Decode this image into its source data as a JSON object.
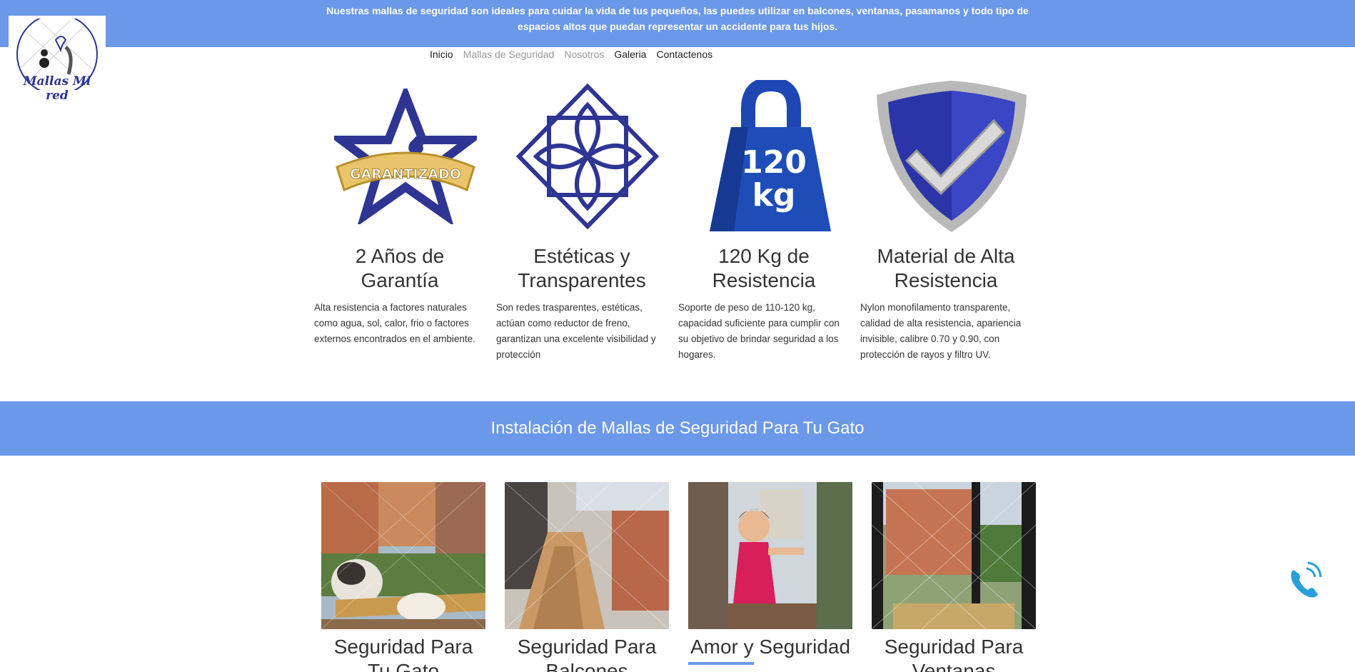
{
  "banner": {
    "text": "Nuestras mallas de seguridad son ideales para cuidar la vida de tus pequeños, las puedes utilizar en balcones, ventanas, pasamanos y todo tipo de espacios altos que puedan representar un accidente para tus hijos."
  },
  "logo": {
    "text": "Mallas Mi red"
  },
  "nav": {
    "items": [
      {
        "label": "Inicio"
      },
      {
        "label": "Mallas de Seguridad"
      },
      {
        "label": "Nosotros"
      },
      {
        "label": "Galeria"
      },
      {
        "label": "Contactenos"
      }
    ]
  },
  "features": [
    {
      "title": "2 Años de Garantía",
      "description": "Alta resistencia a factores naturales como agua, sol, calor, frio o factores externos encontrados en el ambiente.",
      "icon": "guarantee-star-icon",
      "badge": "GARANTIZADO"
    },
    {
      "title": "Estéticas y Transparentes",
      "description": "Son redes trasparentes, estéticas, actúan como reductor de freno, garantizan una excelente visibilidad y protección",
      "icon": "flower-pattern-icon"
    },
    {
      "title": "120 Kg de Resistencia",
      "description": "Soporte de peso de 110-120 kg, capacidad suficiente para cumplir con su objetivo de brindar seguridad a los hogares.",
      "icon": "weight-icon",
      "weight_number": "120",
      "weight_unit": "kg"
    },
    {
      "title": "Material de Alta Resistencia",
      "description": "Nylon monofilamento transparente, calidad de alta resistencia, apariencia invisible, calibre 0.70 y 0.90, con protección de rayos y filtro UV.",
      "icon": "shield-check-icon"
    }
  ],
  "section": {
    "title": "Instalación de Mallas de Seguridad Para Tu Gato"
  },
  "cards": [
    {
      "title": "Seguridad Para Tu Gato"
    },
    {
      "title": "Seguridad Para Balcones"
    },
    {
      "title": "Amor y Seguridad"
    },
    {
      "title": "Seguridad Para Ventanas"
    }
  ],
  "colors": {
    "accent": "#6b98e8",
    "brand_navy": "#2b3590",
    "phone": "#2aa0d8"
  }
}
